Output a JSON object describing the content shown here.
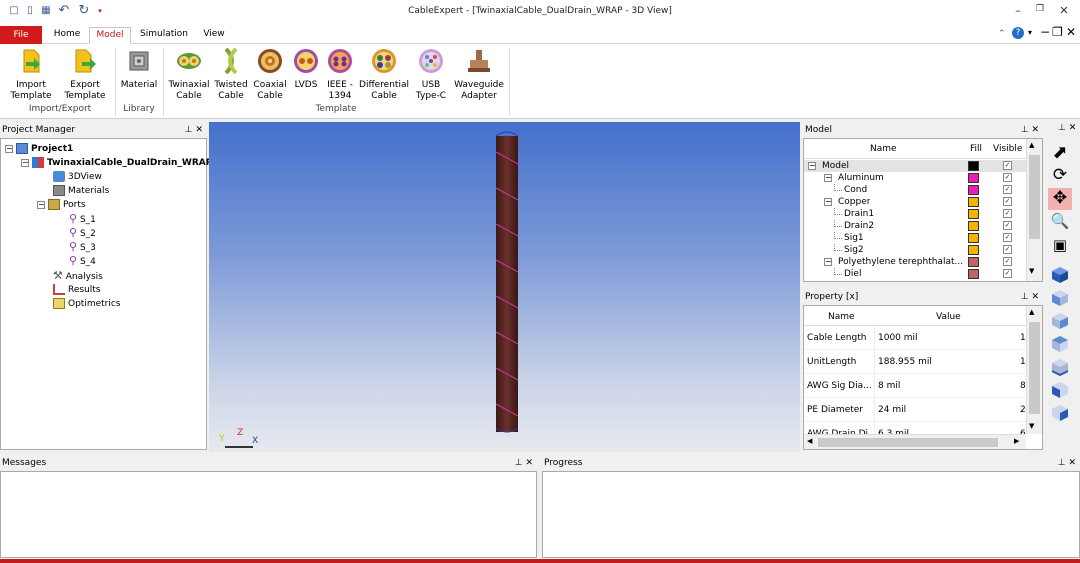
{
  "window": {
    "title": "CableExpert - [TwinaxialCable_DualDrain_WRAP - 3D View]"
  },
  "menu": {
    "file": "File",
    "tabs": [
      "Home",
      "Model",
      "Simulation",
      "View"
    ],
    "active": "Model"
  },
  "ribbon": {
    "import_export": {
      "import": [
        "Import",
        "Template"
      ],
      "export": [
        "Export",
        "Template"
      ],
      "label": "Import/Export"
    },
    "library": {
      "material": "Material",
      "label": "Library"
    },
    "template": {
      "label": "Template",
      "items": [
        {
          "l1": "Twinaxial",
          "l2": "Cable"
        },
        {
          "l1": "Twisted",
          "l2": "Cable"
        },
        {
          "l1": "Coaxial",
          "l2": "Cable"
        },
        {
          "l1": "LVDS",
          "l2": ""
        },
        {
          "l1": "IEEE -",
          "l2": "1394"
        },
        {
          "l1": "Differential",
          "l2": "Cable"
        },
        {
          "l1": "USB",
          "l2": "Type-C"
        },
        {
          "l1": "Waveguide",
          "l2": "Adapter"
        }
      ]
    }
  },
  "project_manager": {
    "title": "Project Manager",
    "project": "Project1",
    "cable": "TwinaxialCable_DualDrain_WRAP",
    "nodes": {
      "view3d": "3DView",
      "materials": "Materials",
      "ports": "Ports",
      "analysis": "Analysis",
      "results": "Results",
      "optimetrics": "Optimetrics"
    },
    "ports": [
      "S_1",
      "S_2",
      "S_3",
      "S_4"
    ]
  },
  "model_panel": {
    "title": "Model",
    "headers": {
      "name": "Name",
      "fill": "Fill",
      "visible": "Visible"
    },
    "rows": [
      {
        "name": "Model",
        "fill": "#000000"
      },
      {
        "name": "Aluminum",
        "fill": "#e81fb4"
      },
      {
        "name": "Cond",
        "fill": "#e81fb4"
      },
      {
        "name": "Copper",
        "fill": "#f5b400"
      },
      {
        "name": "Drain1",
        "fill": "#f5b400"
      },
      {
        "name": "Drain2",
        "fill": "#f5b400"
      },
      {
        "name": "Sig1",
        "fill": "#f5b400"
      },
      {
        "name": "Sig2",
        "fill": "#f5b400"
      },
      {
        "name": "Polyethylene terephthalat...",
        "fill": "#c06560"
      },
      {
        "name": "Diel",
        "fill": "#c06560"
      }
    ]
  },
  "property_panel": {
    "title": "Property [x]",
    "headers": {
      "name": "Name",
      "value": "Value"
    },
    "rows": [
      {
        "name": "Cable Length",
        "value": "1000 mil",
        "extra": "1"
      },
      {
        "name": "UnitLength",
        "value": "188.955 mil",
        "extra": "1"
      },
      {
        "name": "AWG Sig Dia...",
        "value": "8 mil",
        "extra": "8"
      },
      {
        "name": "PE Diameter",
        "value": "24 mil",
        "extra": "2"
      },
      {
        "name": "AWG Drain Di...",
        "value": "6.3 mil",
        "extra": "6"
      }
    ]
  },
  "messages": {
    "title": "Messages"
  },
  "progress": {
    "title": "Progress"
  },
  "viewport": {
    "axis_y": "Y",
    "axis_z": "Z",
    "axis_x": "X"
  },
  "colors": {
    "accent": "#d11b1b",
    "cable": "#5a2a28"
  }
}
